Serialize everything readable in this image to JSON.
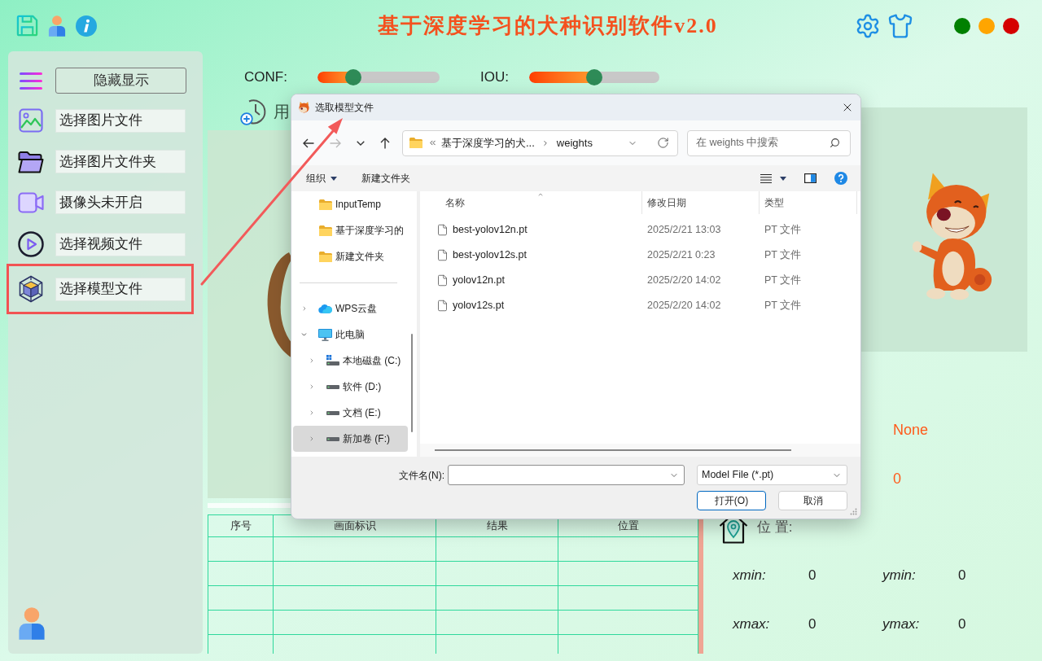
{
  "header": {
    "title": "基于深度学习的犬种识别软件v2.0",
    "window_buttons": [
      {
        "color": "#008000"
      },
      {
        "color": "#ffa500"
      },
      {
        "color": "#d50000"
      }
    ]
  },
  "sidebar": {
    "toggle_button": "隐藏显示",
    "items": [
      {
        "kind": "image",
        "label": "选择图片文件",
        "highlighted": false
      },
      {
        "kind": "folder",
        "label": "选择图片文件夹",
        "highlighted": false
      },
      {
        "kind": "camera",
        "label": "摄像头未开启",
        "highlighted": false
      },
      {
        "kind": "video",
        "label": "选择视频文件",
        "highlighted": false
      },
      {
        "kind": "model",
        "label": "选择模型文件",
        "highlighted": true
      }
    ]
  },
  "thresholds": [
    {
      "label": "CONF:",
      "level": 0.29
    },
    {
      "label": "IOU:",
      "level": 0.5
    }
  ],
  "timer": {
    "label": "用"
  },
  "results": {
    "values": [
      "None",
      "0"
    ]
  },
  "location": {
    "label": "位 置:",
    "coordinates": [
      {
        "label": "xmin:",
        "value": "0"
      },
      {
        "label": "ymin:",
        "value": "0"
      },
      {
        "label": "xmax:",
        "value": "0"
      },
      {
        "label": "ymax:",
        "value": "0"
      }
    ]
  },
  "table": {
    "columns": [
      "序号",
      "画面标识",
      "结果",
      "位置"
    ]
  },
  "dialog": {
    "title": "选取模型文件",
    "nav_buttons": [
      {
        "kind": "back",
        "disabled": false
      },
      {
        "kind": "forward",
        "disabled": true
      },
      {
        "kind": "recent",
        "disabled": false
      },
      {
        "kind": "up",
        "disabled": false
      }
    ],
    "address": [
      "基于深度学习的犬...",
      "weights"
    ],
    "search": {
      "placeholder": "在 weights 中搜索"
    },
    "commands": [
      {
        "kind": "menu",
        "label": "组织"
      },
      {
        "kind": "button",
        "label": "新建文件夹"
      }
    ],
    "quick_access": [
      {
        "kind": "folder",
        "label": "InputTemp",
        "selected": false
      },
      {
        "kind": "folder",
        "label": "基于深度学习的",
        "selected": false
      },
      {
        "kind": "folder",
        "label": "新建文件夹",
        "selected": false
      }
    ],
    "tree": [
      {
        "kind": "cloud",
        "label": "WPS云盘",
        "expanded": false,
        "selected": false
      },
      {
        "kind": "computer",
        "label": "此电脑",
        "expanded": true,
        "selected": false,
        "children": [
          {
            "kind": "system_drive",
            "label": "本地磁盘 (C:)",
            "expanded": false,
            "selected": false
          },
          {
            "kind": "drive",
            "label": "软件 (D:)",
            "expanded": false,
            "selected": false
          },
          {
            "kind": "drive",
            "label": "文档 (E:)",
            "expanded": false,
            "selected": false
          },
          {
            "kind": "drive",
            "label": "新加卷 (F:)",
            "expanded": false,
            "selected": true
          }
        ]
      }
    ],
    "files": {
      "columns": [
        "名称",
        "修改日期",
        "类型"
      ],
      "rows": [
        {
          "name": "best-yolov12n.pt",
          "modified": "2025/2/21 13:03",
          "type": "PT 文件"
        },
        {
          "name": "best-yolov12s.pt",
          "modified": "2025/2/21 0:23",
          "type": "PT 文件"
        },
        {
          "name": "yolov12n.pt",
          "modified": "2025/2/20 14:02",
          "type": "PT 文件"
        },
        {
          "name": "yolov12s.pt",
          "modified": "2025/2/20 14:02",
          "type": "PT 文件"
        }
      ]
    },
    "filename": {
      "label": "文件名(N):"
    },
    "filter": {
      "value": "Model File (*.pt)"
    },
    "buttons": [
      {
        "kind": "primary",
        "label": "打开(O)"
      },
      {
        "kind": "secondary",
        "label": "取消"
      }
    ]
  }
}
